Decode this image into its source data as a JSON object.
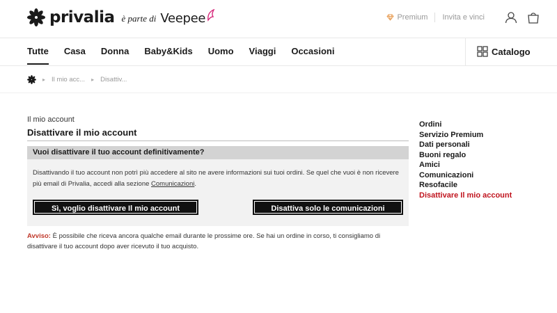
{
  "brand": {
    "name": "privalia",
    "part_of": "è parte di",
    "partner": "Veepee"
  },
  "top_links": {
    "premium": "Premium",
    "invite": "Invita e vinci"
  },
  "nav": {
    "items": [
      {
        "label": "Tutte",
        "active": true
      },
      {
        "label": "Casa"
      },
      {
        "label": "Donna"
      },
      {
        "label": "Baby&Kids"
      },
      {
        "label": "Uomo"
      },
      {
        "label": "Viaggi"
      },
      {
        "label": "Occasioni"
      }
    ],
    "catalog": "Catalogo"
  },
  "breadcrumb": {
    "items": [
      "Il mio acc...",
      "Disattiv..."
    ]
  },
  "main": {
    "account_label": "Il mio account",
    "title": "Disattivare il mio account",
    "question": "Vuoi disattivare il tuo account definitivamente?",
    "info_text": "Disattivando il tuo account non potrì più accedere al sito ne avere informazioni sui tuoi ordini. Se quel che vuoi è non ricevere più email di Privalia, accedi alla sezione ",
    "info_link": "Comunicazioni",
    "info_end": ".",
    "btn_deactivate": "Sì, voglio disattivare Il mio account",
    "btn_comms": "Disattiva solo le comunicazioni",
    "warning_label": "Avviso:",
    "warning_text": " È possibile che riceva ancora qualche email durante le prossime ore. Se hai un ordine in corso, ti consigliamo di disattivare il tuo account dopo aver ricevuto il tuo acquisto."
  },
  "sidebar": {
    "items": [
      {
        "label": "Ordini"
      },
      {
        "label": "Servizio Premium"
      },
      {
        "label": "Dati personali"
      },
      {
        "label": "Buoni regalo"
      },
      {
        "label": "Amici"
      },
      {
        "label": "Comunicazioni"
      },
      {
        "label": "Resofacile"
      },
      {
        "label": "Disattivare Il mio account",
        "active": true
      }
    ]
  },
  "colors": {
    "accent_red": "#c0141e",
    "premium_orange": "#e8a05a",
    "butterfly_pink": "#d6287a"
  },
  "icons": [
    "privalia-flower-icon",
    "butterfly-icon",
    "diamond-icon",
    "user-icon",
    "shopping-bag-icon",
    "grid-icon",
    "home-flower-icon"
  ]
}
